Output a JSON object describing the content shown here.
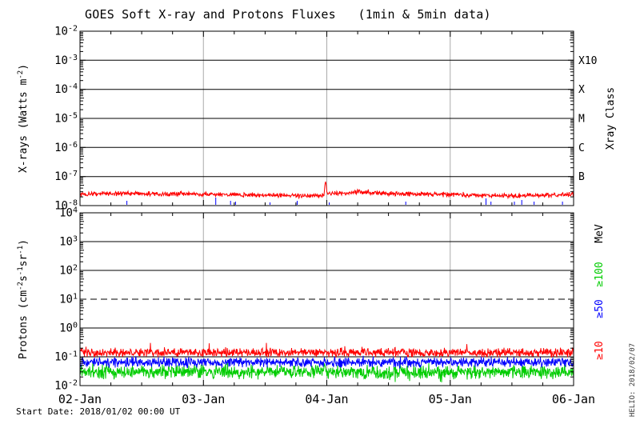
{
  "title": "GOES Soft X-ray and Protons Fluxes   (1min & 5min data)",
  "footer_text": "Start Date: 2018/01/02 00:00 UT",
  "watermark": "HELIO: 2018/02/07",
  "colors": {
    "frame": "#000000",
    "day_gridline": "#aaaaaa",
    "xray_long": "#ff0000",
    "xray_short": "#0000ff",
    "protons_ge10": "#ff0000",
    "protons_ge50": "#0000ff",
    "protons_ge100": "#00cc00",
    "watermark_text": "#3a3a3a"
  },
  "chart_data": [
    {
      "type": "line",
      "panel": "xray",
      "ylabel_segments": [
        {
          "t": "X-rays (Watts m"
        },
        {
          "t": "-2",
          "sup": true
        },
        {
          "t": ")"
        }
      ],
      "ylim": [
        1e-08,
        0.01
      ],
      "y_tick_exponents": [
        -2,
        -3,
        -4,
        -5,
        -6,
        -7,
        -8
      ],
      "x_range_days": [
        0,
        4
      ],
      "x_minor_step_days": 0.25,
      "x_tick_labels": [],
      "grid_days": [
        1,
        2,
        3
      ],
      "solid_hline_exponents": [
        -3,
        -4,
        -5,
        -6,
        -7
      ],
      "dashed_hline_exponents": [],
      "right_axis": {
        "title": "Xray Class",
        "class_labels": [
          {
            "label": "X10",
            "exponent": -3
          },
          {
            "label": "X",
            "exponent": -4
          },
          {
            "label": "M",
            "exponent": -5
          },
          {
            "label": "C",
            "exponent": -6
          },
          {
            "label": "B",
            "exponent": -7
          }
        ]
      },
      "series": [
        {
          "name": "xray-long",
          "color": "#ff0000",
          "kind": "noisy-line",
          "noise_log_sigma": 0.05,
          "baseline_points_day_value": [
            [
              0.0,
              2.45e-08
            ],
            [
              0.2,
              2.55e-08
            ],
            [
              0.45,
              2.6e-08
            ],
            [
              0.7,
              2.5e-08
            ],
            [
              0.95,
              2.45e-08
            ],
            [
              1.2,
              2.4e-08
            ],
            [
              1.5,
              2.25e-08
            ],
            [
              1.8,
              2.2e-08
            ],
            [
              1.96,
              2.25e-08
            ],
            [
              2.02,
              2.6e-08
            ],
            [
              2.15,
              2.7e-08
            ],
            [
              2.25,
              2.95e-08
            ],
            [
              2.4,
              2.8e-08
            ],
            [
              2.6,
              2.55e-08
            ],
            [
              2.9,
              2.45e-08
            ],
            [
              3.2,
              2.3e-08
            ],
            [
              3.5,
              2.15e-08
            ],
            [
              3.75,
              2.25e-08
            ],
            [
              3.9,
              2.4e-08
            ],
            [
              4.0,
              2.5e-08
            ]
          ],
          "spikes": [
            {
              "day": 1.99,
              "peak_value": 6.5e-08,
              "width_days": 0.008
            }
          ]
        },
        {
          "name": "xray-short",
          "color": "#0000ff",
          "kind": "baseline-spikes",
          "spikes_day_heightpx": [
            [
              0.38,
              5
            ],
            [
              1.1,
              9
            ],
            [
              1.22,
              5
            ],
            [
              1.26,
              4
            ],
            [
              1.54,
              3
            ],
            [
              1.76,
              5
            ],
            [
              2.02,
              3
            ],
            [
              2.64,
              4
            ],
            [
              3.29,
              8
            ],
            [
              3.33,
              4
            ],
            [
              3.52,
              4
            ],
            [
              3.58,
              6
            ],
            [
              3.68,
              4
            ],
            [
              3.91,
              4
            ]
          ]
        }
      ]
    },
    {
      "type": "line",
      "panel": "protons",
      "ylabel_segments": [
        {
          "t": "Protons (cm"
        },
        {
          "t": "-2",
          "sup": true
        },
        {
          "t": "s"
        },
        {
          "t": "-1",
          "sup": true
        },
        {
          "t": "sr"
        },
        {
          "t": "-1",
          "sup": true
        },
        {
          "t": ")"
        }
      ],
      "ylim": [
        0.01,
        10000.0
      ],
      "y_tick_exponents": [
        4,
        3,
        2,
        1,
        0,
        -1,
        -2
      ],
      "x_range_days": [
        0,
        4
      ],
      "x_minor_step_days": 0.25,
      "x_tick_labels": [
        "02-Jan",
        "03-Jan",
        "04-Jan",
        "05-Jan",
        "06-Jan"
      ],
      "grid_days": [
        1,
        2,
        3
      ],
      "solid_hline_exponents": [
        3,
        2,
        0,
        -1
      ],
      "dashed_hline_exponents": [
        1
      ],
      "right_axis": {
        "title": "MeV",
        "energy_labels": [
          {
            "label": "≥100",
            "color": "#00cc00"
          },
          {
            "label": "≥50",
            "color": "#0000ff"
          },
          {
            "label": "≥10",
            "color": "#ff0000"
          }
        ]
      },
      "series": [
        {
          "name": "protons-ge100",
          "color": "#00cc00",
          "kind": "noisy-line",
          "baseline_value": 0.03,
          "noise_log_sigma": 0.14,
          "down_spike_prob": 0.02,
          "down_spike_log": 0.18,
          "up_spike_prob": 0.008,
          "up_spike_log": 0.25
        },
        {
          "name": "protons-ge50",
          "color": "#0000ff",
          "kind": "noisy-line",
          "baseline_value": 0.065,
          "noise_log_sigma": 0.1,
          "up_spike_prob": 0.004,
          "up_spike_log": 0.2
        },
        {
          "name": "protons-ge10",
          "color": "#ff0000",
          "kind": "noisy-line",
          "baseline_value": 0.14,
          "noise_log_sigma": 0.09,
          "up_spike_prob": 0.006,
          "up_spike_log": 0.25
        }
      ]
    }
  ]
}
